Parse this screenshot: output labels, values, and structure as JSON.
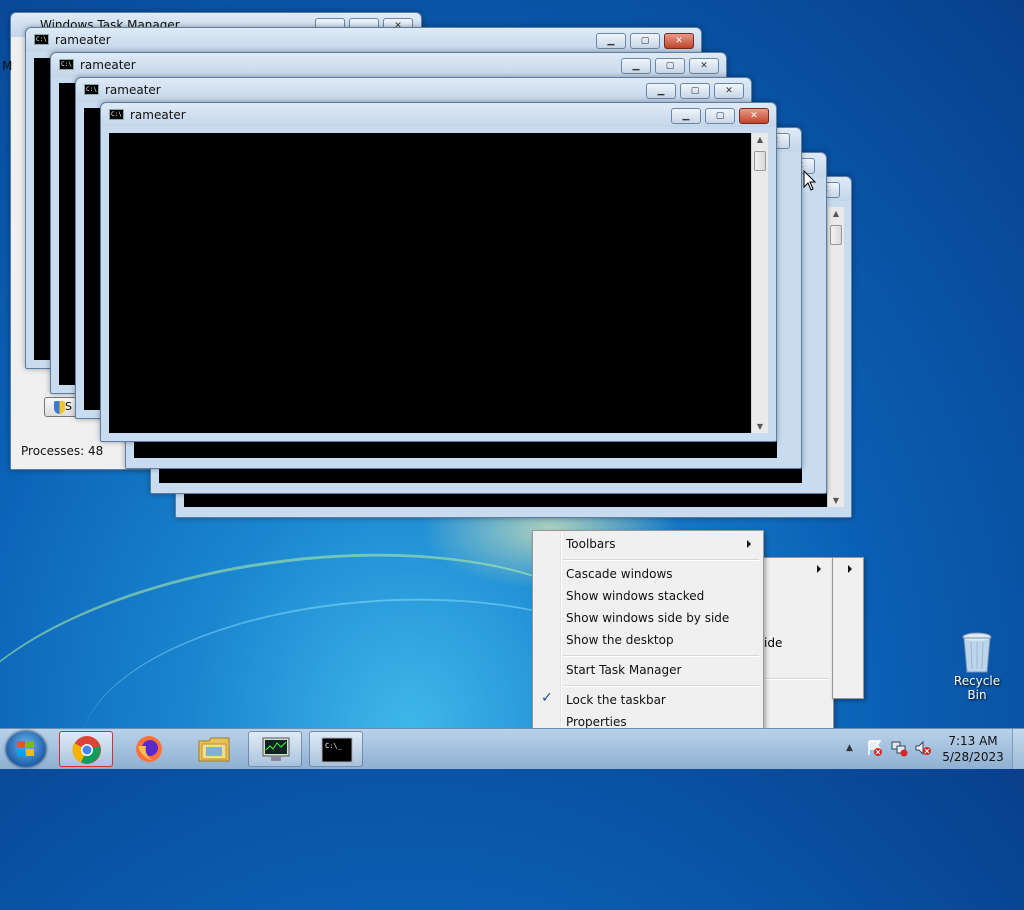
{
  "desktop": {
    "recycle_bin_label": "Recycle Bin"
  },
  "task_manager": {
    "title": "Windows Task Manager",
    "status_processes": "Processes: 48",
    "show_button_label": "S",
    "side_menu_label_fragment": "M"
  },
  "windows": [
    {
      "title": "rameater"
    },
    {
      "title": "rameater"
    },
    {
      "title": "rameater"
    },
    {
      "title": "rameater"
    }
  ],
  "context_menu": {
    "items": [
      {
        "label": "Toolbars",
        "submenu": true
      },
      {
        "label": "Cascade windows"
      },
      {
        "label": "Show windows stacked"
      },
      {
        "label": "Show windows side by side"
      },
      {
        "label": "Show the desktop"
      },
      {
        "label": "Start Task Manager"
      },
      {
        "label": "Lock the taskbar",
        "checked": true
      },
      {
        "label": "Properties"
      }
    ],
    "behind_menu_fragment": "ide"
  },
  "taskbar": {
    "clock_time": "7:13 AM",
    "clock_date": "5/28/2023",
    "pinned": [
      "chrome-icon",
      "firefox-icon",
      "explorer-folder-icon",
      "task-manager-icon",
      "cmd-icon"
    ],
    "active_item": "cmd-icon"
  },
  "colors": {
    "close_button": "#c0442b",
    "taskbar": "#a6c3e0",
    "console_bg": "#000000"
  }
}
